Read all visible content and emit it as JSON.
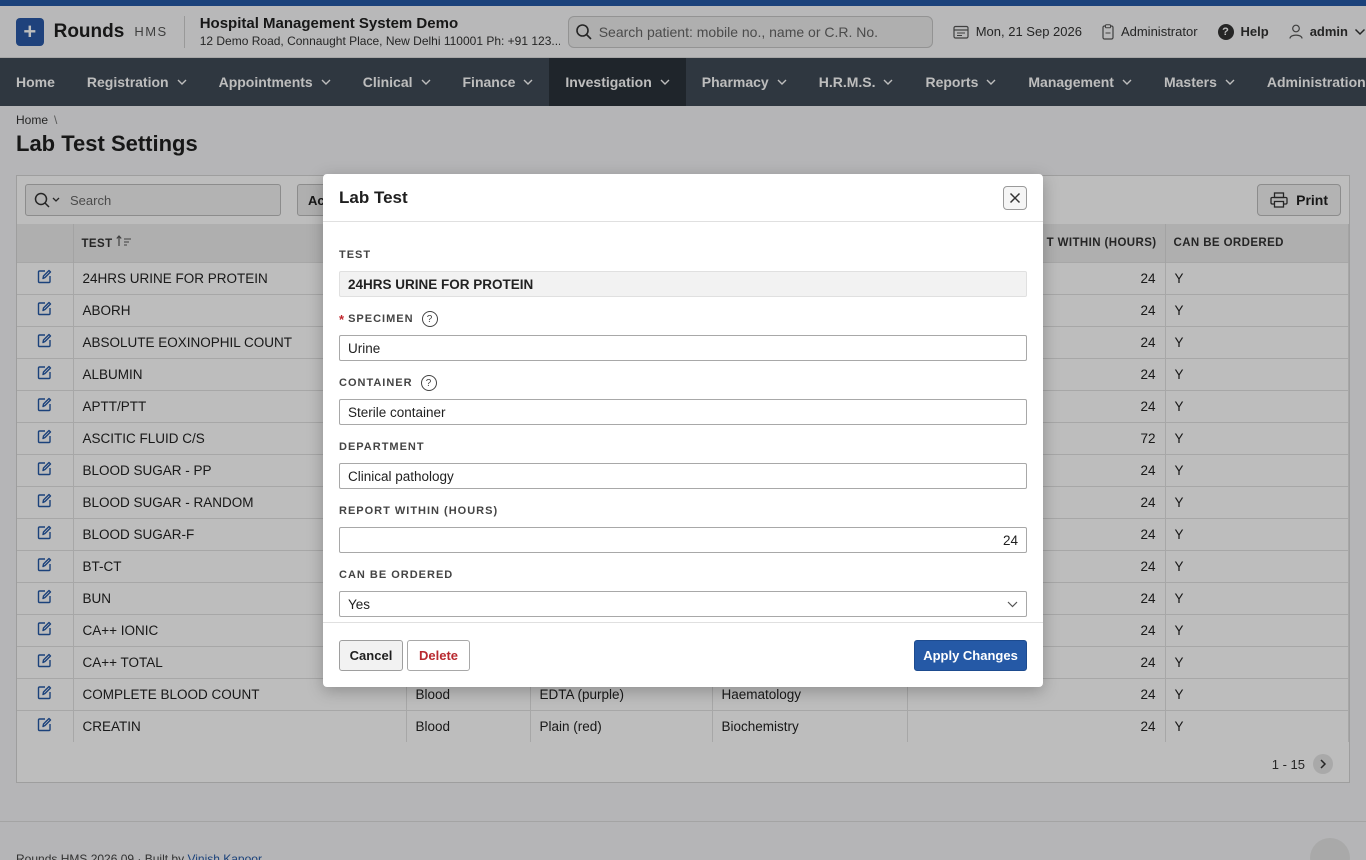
{
  "header": {
    "app_name": "Rounds",
    "app_sub": "HMS",
    "org_title": "Hospital Management System Demo",
    "org_address": "12 Demo Road, Connaught Place, New Delhi 110001 Ph: +91 123...",
    "search_placeholder": "Search patient: mobile no., name or C.R. No.",
    "date": "Mon, 21 Sep 2026",
    "role": "Administrator",
    "help": "Help",
    "user": "admin"
  },
  "nav": [
    "Home",
    "Registration",
    "Appointments",
    "Clinical",
    "Finance",
    "Investigation",
    "Pharmacy",
    "H.R.M.S.",
    "Reports",
    "Management",
    "Masters",
    "Administration"
  ],
  "breadcrumb": {
    "home": "Home",
    "sep": "\\"
  },
  "page_title": "Lab Test Settings",
  "grid": {
    "search_placeholder": "Search",
    "actions_label": "Ac",
    "print_label": "Print",
    "columns": {
      "test": "TEST",
      "report_within": "T WITHIN (HOURS)",
      "can_be_ordered": "CAN BE ORDERED"
    },
    "rows": [
      {
        "test": "24HRS URINE FOR PROTEIN",
        "specimen": "",
        "container": "",
        "department": "",
        "hours": "24",
        "ordered": "Y"
      },
      {
        "test": "ABORH",
        "specimen": "",
        "container": "",
        "department": "",
        "hours": "24",
        "ordered": "Y"
      },
      {
        "test": "ABSOLUTE EOXINOPHIL COUNT",
        "specimen": "",
        "container": "",
        "department": "",
        "hours": "24",
        "ordered": "Y"
      },
      {
        "test": "ALBUMIN",
        "specimen": "",
        "container": "",
        "department": "",
        "hours": "24",
        "ordered": "Y"
      },
      {
        "test": "APTT/PTT",
        "specimen": "",
        "container": "",
        "department": "",
        "hours": "24",
        "ordered": "Y"
      },
      {
        "test": "ASCITIC FLUID C/S",
        "specimen": "",
        "container": "",
        "department": "",
        "hours": "72",
        "ordered": "Y"
      },
      {
        "test": "BLOOD SUGAR - PP",
        "specimen": "",
        "container": "",
        "department": "",
        "hours": "24",
        "ordered": "Y"
      },
      {
        "test": "BLOOD SUGAR - RANDOM",
        "specimen": "",
        "container": "",
        "department": "",
        "hours": "24",
        "ordered": "Y"
      },
      {
        "test": "BLOOD SUGAR-F",
        "specimen": "",
        "container": "",
        "department": "",
        "hours": "24",
        "ordered": "Y"
      },
      {
        "test": "BT-CT",
        "specimen": "",
        "container": "",
        "department": "",
        "hours": "24",
        "ordered": "Y"
      },
      {
        "test": "BUN",
        "specimen": "",
        "container": "",
        "department": "",
        "hours": "24",
        "ordered": "Y"
      },
      {
        "test": "CA++ IONIC",
        "specimen": "",
        "container": "",
        "department": "",
        "hours": "24",
        "ordered": "Y"
      },
      {
        "test": "CA++ TOTAL",
        "specimen": "",
        "container": "",
        "department": "",
        "hours": "24",
        "ordered": "Y"
      },
      {
        "test": "COMPLETE BLOOD COUNT",
        "specimen": "Blood",
        "container": "EDTA (purple)",
        "department": "Haematology",
        "hours": "24",
        "ordered": "Y"
      },
      {
        "test": "CREATIN",
        "specimen": "Blood",
        "container": "Plain (red)",
        "department": "Biochemistry",
        "hours": "24",
        "ordered": "Y"
      }
    ],
    "pagination": "1 - 15"
  },
  "footer": {
    "version": "Rounds HMS 2026.09",
    "built_by": "Built by",
    "author": "Vinish Kapoor"
  },
  "dialog": {
    "title": "Lab Test",
    "test_label": "TEST",
    "test_value": "24HRS URINE FOR PROTEIN",
    "specimen_label": "SPECIMEN",
    "specimen_value": "Urine",
    "container_label": "CONTAINER",
    "container_value": "Sterile container",
    "department_label": "DEPARTMENT",
    "department_value": "Clinical pathology",
    "report_label": "REPORT WITHIN (HOURS)",
    "report_value": "24",
    "ordered_label": "CAN BE ORDERED",
    "ordered_value": "Yes",
    "cancel": "Cancel",
    "delete": "Delete",
    "apply": "Apply Changes"
  },
  "colors": {
    "accent": "#2559a6",
    "nav": "#404b57",
    "nav_active": "#2b323b",
    "delete": "#b8292f"
  }
}
